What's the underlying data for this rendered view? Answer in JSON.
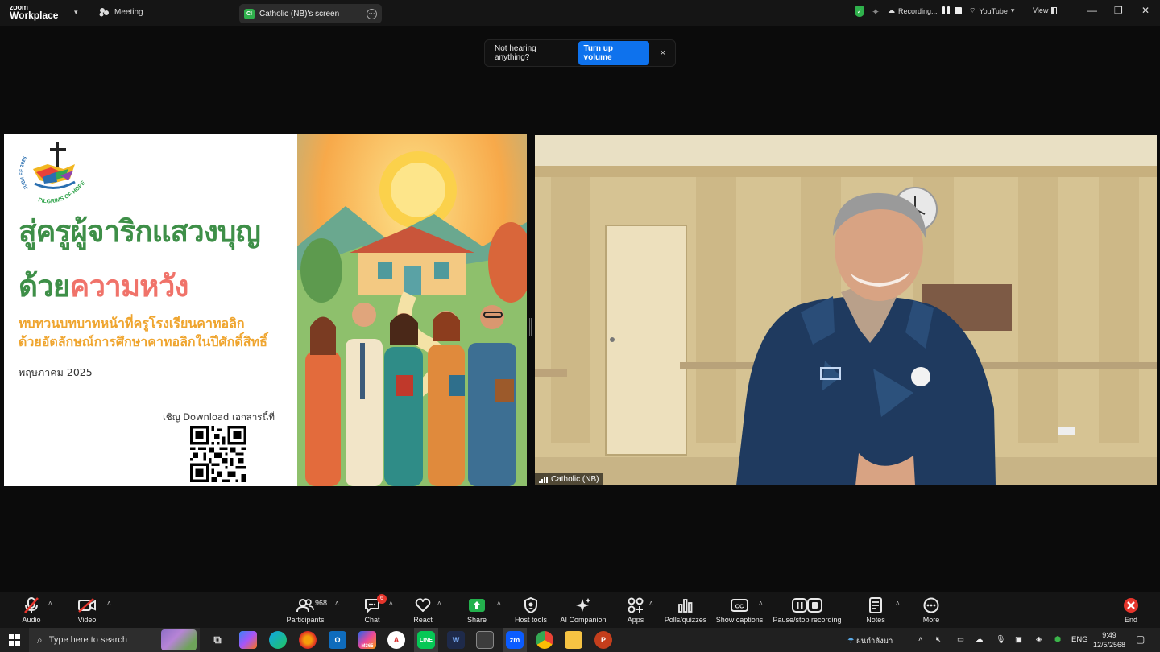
{
  "app": {
    "brand_top": "zoom",
    "brand_bottom": "Workplace",
    "meeting_label": "Meeting"
  },
  "share_tab": {
    "label": "Catholic (NB)'s screen",
    "avatar_text": "CI"
  },
  "status": {
    "recording": "Recording...",
    "youtube": "YouTube",
    "view": "View"
  },
  "notice": {
    "text": "Not hearing anything?",
    "button": "Turn up volume",
    "close": "×"
  },
  "slide": {
    "logo_arc": "JUBILEE 2025",
    "logo_text": "PILGRIMS OF HOPE",
    "title_line1": "สู่ครูผู้จาริกแสวงบุญ",
    "title_line2_a": "ด้วย",
    "title_line2_b": "ความหวัง",
    "subtitle_line1": "ทบทวนบทบาทหน้าที่ครูโรงเรียนคาทอลิก",
    "subtitle_line2": "ด้วยอัตลักษณ์การศึกษาคาทอลิกในปีศักดิ์สิทธิ์",
    "date": "พฤษภาคม 2025",
    "download_text": "เชิญ Download เอกสารนี้ที่"
  },
  "video": {
    "participant_name": "Catholic (NB)"
  },
  "toolbar": {
    "audio": "Audio",
    "video": "Video",
    "participants": "Participants",
    "participants_count": "968",
    "chat": "Chat",
    "chat_badge": "6",
    "react": "React",
    "share": "Share",
    "host_tools": "Host tools",
    "ai_companion": "AI Companion",
    "apps": "Apps",
    "polls": "Polls/quizzes",
    "captions": "Show captions",
    "recording": "Pause/stop recording",
    "notes": "Notes",
    "more": "More",
    "end": "End"
  },
  "taskbar": {
    "search_placeholder": "Type here to search",
    "weather": "ฝนกำลังมา",
    "language": "ENG",
    "time": "9:49",
    "date": "12/5/2568",
    "zoom_app": "zm",
    "m365_label": "M365"
  },
  "colors": {
    "accent_blue": "#0e72ed",
    "record_green": "#2fb14c",
    "title_green": "#3e8f48",
    "title_pink": "#f0736a",
    "subtitle_orange": "#efa52f",
    "end_red": "#e5352c"
  }
}
